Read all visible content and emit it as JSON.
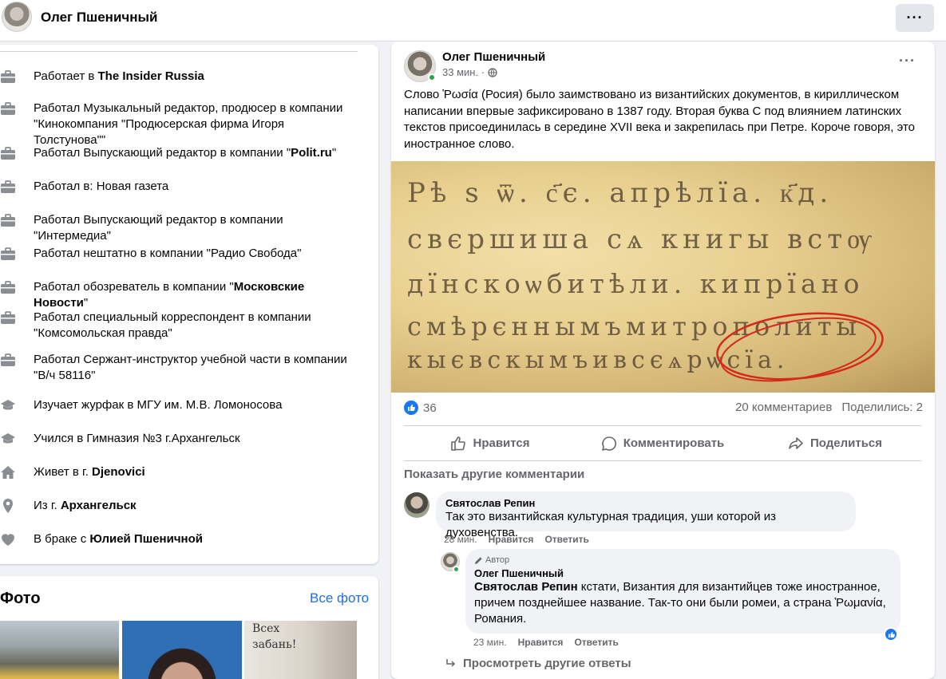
{
  "header": {
    "profile_name": "Олег Пшеничный",
    "more_label": "···"
  },
  "intro": {
    "items": [
      {
        "icon": "briefcase-icon",
        "prefix": "Работает в ",
        "bold": "The Insider Russia",
        "suffix": ""
      },
      {
        "icon": "briefcase-icon",
        "prefix": "Работал Музыкальный редактор, продюсер в компании \"Кинокомпания \"Продюсерская фирма Игоря Толстунова\"\"",
        "bold": "",
        "suffix": ""
      },
      {
        "icon": "briefcase-icon",
        "prefix": "Работал Выпускающий редактор в компании \"",
        "bold": "Polit.ru",
        "suffix": "\""
      },
      {
        "icon": "briefcase-icon",
        "prefix": "Работал в: Новая газета",
        "bold": "",
        "suffix": ""
      },
      {
        "icon": "briefcase-icon",
        "prefix": "Работал Выпускающий редактор в компании \"Интермедиа\"",
        "bold": "",
        "suffix": ""
      },
      {
        "icon": "briefcase-icon",
        "prefix": "Работал нештатно в компании \"Радио Свобода\"",
        "bold": "",
        "suffix": ""
      },
      {
        "icon": "briefcase-icon",
        "prefix": "Работал обозреватель в компании \"",
        "bold": "Московские Новости",
        "suffix": "\""
      },
      {
        "icon": "briefcase-icon",
        "prefix": "Работал специальный корреспондент в компании \"Комсомольская правда\"",
        "bold": "",
        "suffix": ""
      },
      {
        "icon": "briefcase-icon",
        "prefix": "Работал Сержант-инструктор учебной части в компании \"В/ч 58116\"",
        "bold": "",
        "suffix": ""
      },
      {
        "icon": "graduation-cap-icon",
        "prefix": "Изучает журфак в МГУ им. М.В. Ломоносова",
        "bold": "",
        "suffix": ""
      },
      {
        "icon": "graduation-cap-icon",
        "prefix": "Учился в Гимназия №3 г.Архангельск",
        "bold": "",
        "suffix": ""
      },
      {
        "icon": "home-icon",
        "prefix": "Живет в г. ",
        "bold": "Djenovici",
        "suffix": ""
      },
      {
        "icon": "location-pin-icon",
        "prefix": "Из г. ",
        "bold": "Архангельск",
        "suffix": ""
      },
      {
        "icon": "heart-icon",
        "prefix": "В браке с ",
        "bold": "Юлией Пшеничной",
        "suffix": ""
      }
    ]
  },
  "photos": {
    "title": "Фото",
    "all_link": "Все фото",
    "photo3_caption": "Всех\nзабань!"
  },
  "post": {
    "author": "Олег Пшеничный",
    "time": "33 мин. ·",
    "privacy_icon": "globe-icon",
    "text": "Слово Ῥωσία (Росия) было заимствовано из византийских документов, в кириллическом написании впервые зафиксировано в 1387 году. Вторая буква С под влиянием латинских текстов присоединилась в середине XVII века и закрепилась при Петре. Короче говоря, это иностранное слово.",
    "image_lines": [
      "Рѣ ѕ ѿ. с҃є. апрѣлїа. к҃д.",
      "свєршиша сѧ книгы встѹ",
      "дїнскоѡбитѣли. кипрїано",
      "смѣрєннымъмитрополиты",
      "кыєвскымъивсєѧрѡсїа."
    ],
    "reactions_count": "36",
    "comments_count": "20 комментариев",
    "shares_count": "Поделились: 2",
    "actions": {
      "like": "Нравится",
      "comment": "Комментировать",
      "share": "Поделиться"
    },
    "show_more_comments": "Показать другие комментарии"
  },
  "comments": [
    {
      "author": "Святослав Репин",
      "text": "Так это византийская культурная традиция, уши которой из духовенства.",
      "time": "28 мин.",
      "like": "Нравится",
      "reply": "Ответить"
    }
  ],
  "reply": {
    "badge": "Автор",
    "author": "Олег Пшеничный",
    "mention": "Святослав Репин",
    "text": " кстати, Византия для византийцев тоже иностранное, причем позднейшее название. Так-то они были ромеи, а страна Ῥωμανία, Романия.",
    "time": "23 мин.",
    "like": "Нравится",
    "reply": "Ответить"
  },
  "view_more_replies": "Просмотреть другие ответы",
  "colors": {
    "accent": "#1877f2",
    "link": "#216fdb",
    "secondary_text": "#65676b",
    "online": "#31a24c",
    "annotation_red": "#d42a1e"
  }
}
